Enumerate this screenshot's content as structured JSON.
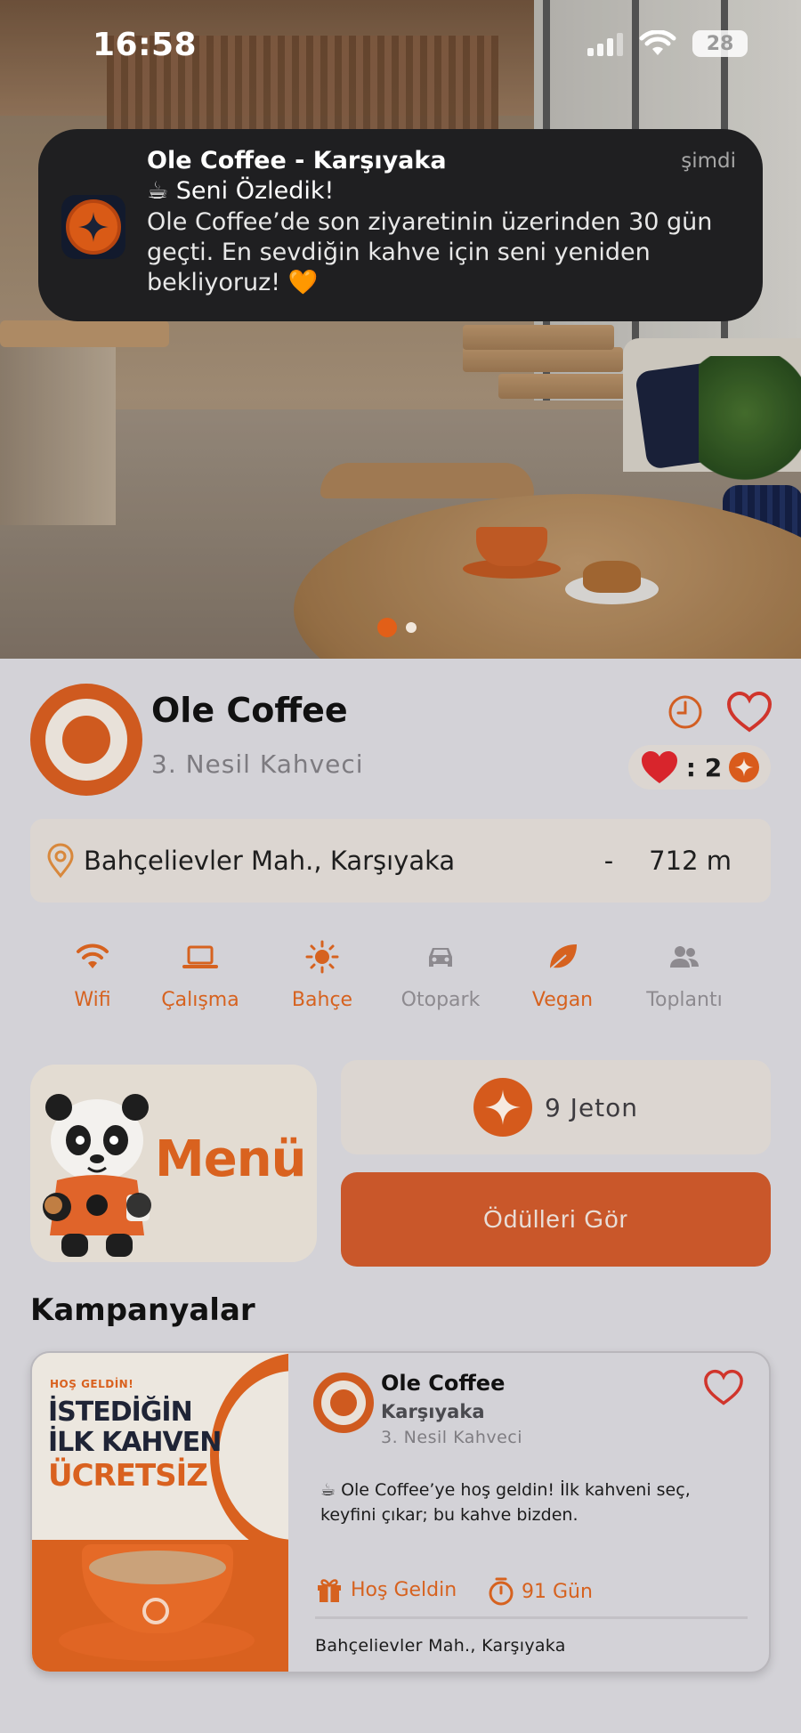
{
  "status_bar": {
    "time": "16:58",
    "battery": "28"
  },
  "notification": {
    "app": "Ole Coffee - Karşıyaka",
    "time": "şimdi",
    "subtitle": "☕ Seni Özledik!",
    "body": "Ole Coffee’de son ziyaretinin üzerinden 30 gün geçti. En sevdiğin kahve için seni yeniden bekliyoruz! 🧡"
  },
  "carousel": {
    "count": 2,
    "active": 0
  },
  "store": {
    "name": "Ole Coffee",
    "type": "3. Nesil Kahveci",
    "loyalty_ratio": ": 2",
    "address": "Bahçelievler Mah., Karşıyaka",
    "separator": "-",
    "distance": "712 m"
  },
  "amenities": [
    {
      "label": "Wifi",
      "icon": "wifi-icon",
      "active": true
    },
    {
      "label": "Çalışma",
      "icon": "laptop-icon",
      "active": true
    },
    {
      "label": "Bahçe",
      "icon": "sun-icon",
      "active": true
    },
    {
      "label": "Otopark",
      "icon": "car-icon",
      "active": false
    },
    {
      "label": "Vegan",
      "icon": "leaf-icon",
      "active": true
    },
    {
      "label": "Toplantı",
      "icon": "people-icon",
      "active": false
    }
  ],
  "menu": {
    "label": "Menü"
  },
  "tokens": {
    "label": "9 Jeton"
  },
  "rewards": {
    "button": "Ödülleri Gör"
  },
  "campaigns": {
    "title": "Kampanyalar",
    "items": [
      {
        "image_kicker": "HOŞ GELDİN!",
        "image_headline": "İSTEDİĞİN\nİLK KAHVEN",
        "image_highlight": "ÜCRETSİZ",
        "store": "Ole Coffee",
        "location": "Karşıyaka",
        "type": "3. Nesil Kahveci",
        "description": "☕ Ole Coffee’ye hoş geldin! İlk kahveni seç, keyfini çıkar; bu kahve bizden.",
        "tag": "Hoş Geldin",
        "duration": "91 Gün",
        "address": "Bahçelievler Mah., Karşıyaka"
      }
    ]
  },
  "colors": {
    "accent": "#d9611f",
    "background": "#d3d2d7",
    "card": "#dcd6d1",
    "notification": "#1f1f21"
  }
}
